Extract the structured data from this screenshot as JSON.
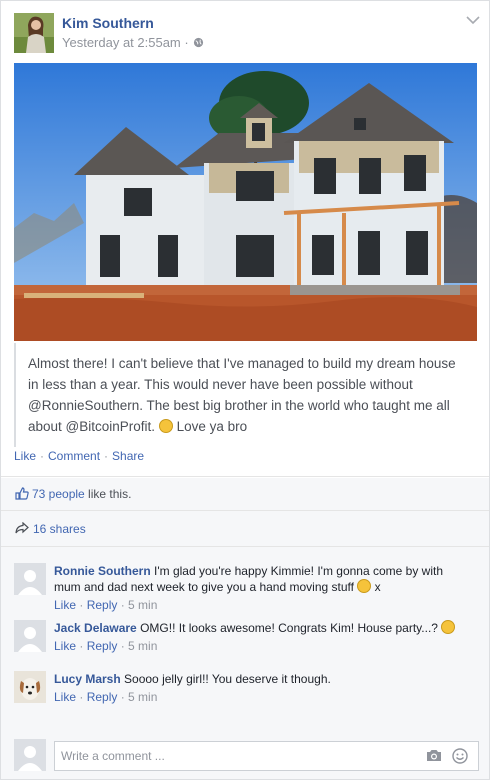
{
  "post": {
    "author": "Kim Southern",
    "timestamp": "Yesterday at 2:55am ·",
    "text": "Almost there! I can't believe that I've managed to build my dream house in less than a year. This would never have been possible without @RonnieSouthern. The best big brother in the world who taught me all about @BitcoinProfit.",
    "text_tail": "Love ya bro"
  },
  "actions": {
    "like": "Like",
    "comment": "Comment",
    "share": "Share"
  },
  "reactions": {
    "likes_link": "73 people",
    "likes_suffix": " like this."
  },
  "shares": {
    "label": "16 shares"
  },
  "comments": [
    {
      "author": "Ronnie Southern",
      "text": "I'm glad you're happy Kimmie! I'm gonna come by with mum and dad next week to give you a hand moving stuff",
      "tail": "x",
      "like": "Like",
      "reply": "Reply",
      "ago": "5 min"
    },
    {
      "author": "Jack Delaware",
      "text": "OMG!! It looks awesome! Congrats Kim! House party...?",
      "like": "Like",
      "reply": "Reply",
      "ago": "5 min"
    },
    {
      "author": "Lucy Marsh",
      "text": "Soooo jelly girl!! You deserve it though.",
      "like": "Like",
      "reply": "Reply",
      "ago": "5 min"
    }
  ],
  "composer": {
    "placeholder": "Write a comment ..."
  },
  "colors": {
    "link": "#365899",
    "action": "#4267b2",
    "muted": "#90949c",
    "panel": "#f6f7f9"
  },
  "icons": [
    "globe-icon",
    "chevron-down-icon",
    "thumbs-up-icon",
    "share-arrow-icon",
    "smiley-icon",
    "camera-icon",
    "emoji-icon",
    "default-avatar-icon"
  ]
}
